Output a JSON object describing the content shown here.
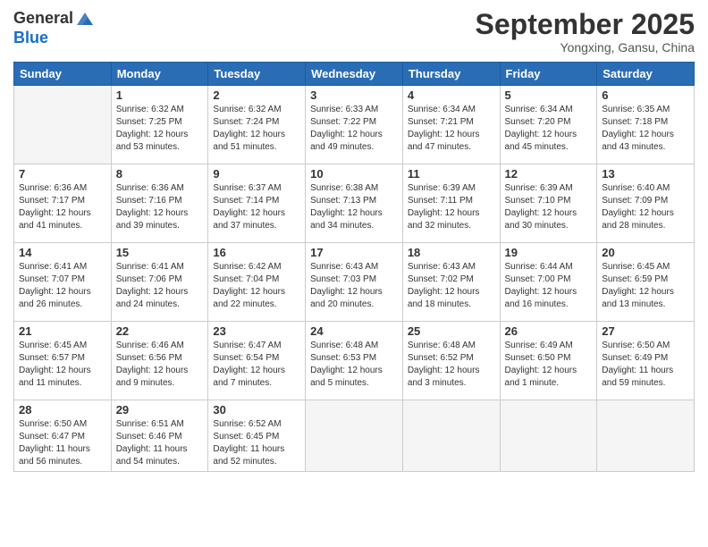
{
  "logo": {
    "line1": "General",
    "line2": "Blue"
  },
  "title": "September 2025",
  "location": "Yongxing, Gansu, China",
  "days_of_week": [
    "Sunday",
    "Monday",
    "Tuesday",
    "Wednesday",
    "Thursday",
    "Friday",
    "Saturday"
  ],
  "weeks": [
    [
      {
        "day": "",
        "content": ""
      },
      {
        "day": "1",
        "content": "Sunrise: 6:32 AM\nSunset: 7:25 PM\nDaylight: 12 hours\nand 53 minutes."
      },
      {
        "day": "2",
        "content": "Sunrise: 6:32 AM\nSunset: 7:24 PM\nDaylight: 12 hours\nand 51 minutes."
      },
      {
        "day": "3",
        "content": "Sunrise: 6:33 AM\nSunset: 7:22 PM\nDaylight: 12 hours\nand 49 minutes."
      },
      {
        "day": "4",
        "content": "Sunrise: 6:34 AM\nSunset: 7:21 PM\nDaylight: 12 hours\nand 47 minutes."
      },
      {
        "day": "5",
        "content": "Sunrise: 6:34 AM\nSunset: 7:20 PM\nDaylight: 12 hours\nand 45 minutes."
      },
      {
        "day": "6",
        "content": "Sunrise: 6:35 AM\nSunset: 7:18 PM\nDaylight: 12 hours\nand 43 minutes."
      }
    ],
    [
      {
        "day": "7",
        "content": "Sunrise: 6:36 AM\nSunset: 7:17 PM\nDaylight: 12 hours\nand 41 minutes."
      },
      {
        "day": "8",
        "content": "Sunrise: 6:36 AM\nSunset: 7:16 PM\nDaylight: 12 hours\nand 39 minutes."
      },
      {
        "day": "9",
        "content": "Sunrise: 6:37 AM\nSunset: 7:14 PM\nDaylight: 12 hours\nand 37 minutes."
      },
      {
        "day": "10",
        "content": "Sunrise: 6:38 AM\nSunset: 7:13 PM\nDaylight: 12 hours\nand 34 minutes."
      },
      {
        "day": "11",
        "content": "Sunrise: 6:39 AM\nSunset: 7:11 PM\nDaylight: 12 hours\nand 32 minutes."
      },
      {
        "day": "12",
        "content": "Sunrise: 6:39 AM\nSunset: 7:10 PM\nDaylight: 12 hours\nand 30 minutes."
      },
      {
        "day": "13",
        "content": "Sunrise: 6:40 AM\nSunset: 7:09 PM\nDaylight: 12 hours\nand 28 minutes."
      }
    ],
    [
      {
        "day": "14",
        "content": "Sunrise: 6:41 AM\nSunset: 7:07 PM\nDaylight: 12 hours\nand 26 minutes."
      },
      {
        "day": "15",
        "content": "Sunrise: 6:41 AM\nSunset: 7:06 PM\nDaylight: 12 hours\nand 24 minutes."
      },
      {
        "day": "16",
        "content": "Sunrise: 6:42 AM\nSunset: 7:04 PM\nDaylight: 12 hours\nand 22 minutes."
      },
      {
        "day": "17",
        "content": "Sunrise: 6:43 AM\nSunset: 7:03 PM\nDaylight: 12 hours\nand 20 minutes."
      },
      {
        "day": "18",
        "content": "Sunrise: 6:43 AM\nSunset: 7:02 PM\nDaylight: 12 hours\nand 18 minutes."
      },
      {
        "day": "19",
        "content": "Sunrise: 6:44 AM\nSunset: 7:00 PM\nDaylight: 12 hours\nand 16 minutes."
      },
      {
        "day": "20",
        "content": "Sunrise: 6:45 AM\nSunset: 6:59 PM\nDaylight: 12 hours\nand 13 minutes."
      }
    ],
    [
      {
        "day": "21",
        "content": "Sunrise: 6:45 AM\nSunset: 6:57 PM\nDaylight: 12 hours\nand 11 minutes."
      },
      {
        "day": "22",
        "content": "Sunrise: 6:46 AM\nSunset: 6:56 PM\nDaylight: 12 hours\nand 9 minutes."
      },
      {
        "day": "23",
        "content": "Sunrise: 6:47 AM\nSunset: 6:54 PM\nDaylight: 12 hours\nand 7 minutes."
      },
      {
        "day": "24",
        "content": "Sunrise: 6:48 AM\nSunset: 6:53 PM\nDaylight: 12 hours\nand 5 minutes."
      },
      {
        "day": "25",
        "content": "Sunrise: 6:48 AM\nSunset: 6:52 PM\nDaylight: 12 hours\nand 3 minutes."
      },
      {
        "day": "26",
        "content": "Sunrise: 6:49 AM\nSunset: 6:50 PM\nDaylight: 12 hours\nand 1 minute."
      },
      {
        "day": "27",
        "content": "Sunrise: 6:50 AM\nSunset: 6:49 PM\nDaylight: 11 hours\nand 59 minutes."
      }
    ],
    [
      {
        "day": "28",
        "content": "Sunrise: 6:50 AM\nSunset: 6:47 PM\nDaylight: 11 hours\nand 56 minutes."
      },
      {
        "day": "29",
        "content": "Sunrise: 6:51 AM\nSunset: 6:46 PM\nDaylight: 11 hours\nand 54 minutes."
      },
      {
        "day": "30",
        "content": "Sunrise: 6:52 AM\nSunset: 6:45 PM\nDaylight: 11 hours\nand 52 minutes."
      },
      {
        "day": "",
        "content": ""
      },
      {
        "day": "",
        "content": ""
      },
      {
        "day": "",
        "content": ""
      },
      {
        "day": "",
        "content": ""
      }
    ]
  ]
}
